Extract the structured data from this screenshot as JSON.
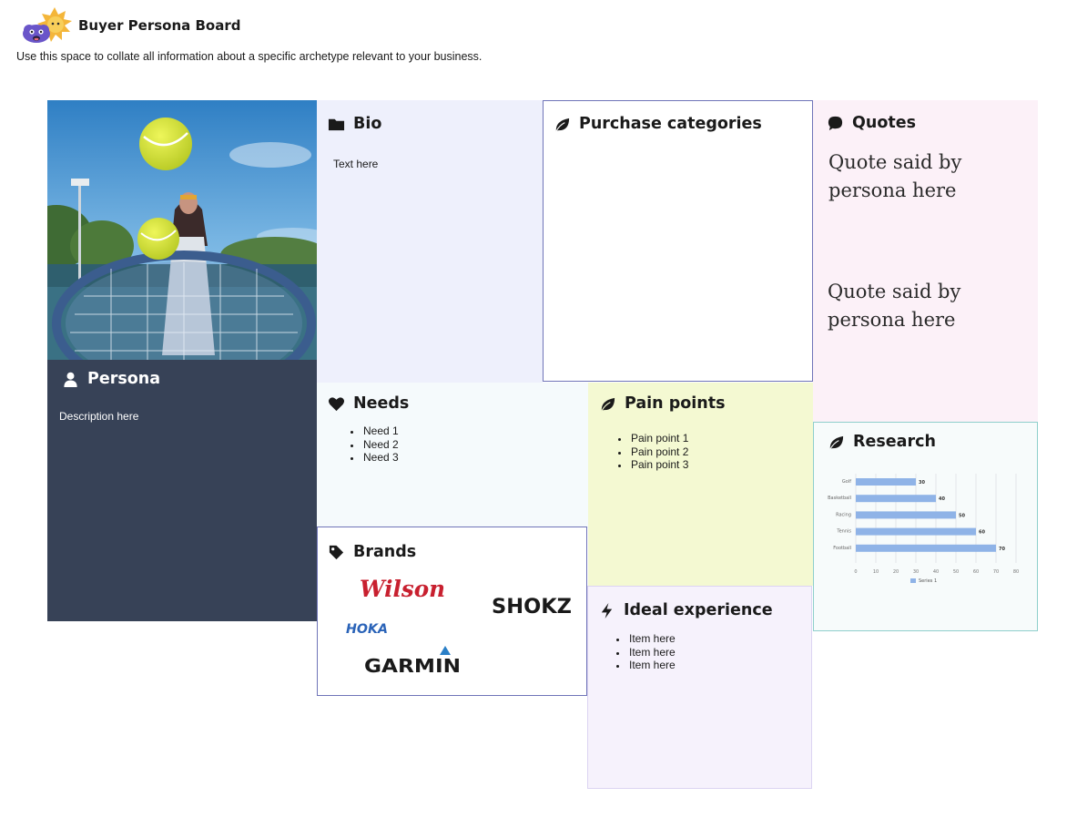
{
  "app": {
    "title": "Buyer Persona Board",
    "subtitle": "Use this space to collate all information about a specific archetype relevant to your business."
  },
  "persona": {
    "title": "Persona",
    "icon": "user-icon",
    "description": "Description here"
  },
  "bio": {
    "title": "Bio",
    "icon": "folder-icon",
    "text": "Text here"
  },
  "purchase": {
    "title": "Purchase categories",
    "icon": "leaf-icon"
  },
  "quotes": {
    "title": "Quotes",
    "icon": "speech-bubble-icon",
    "items": [
      "Quote said by persona here",
      "Quote said by persona here"
    ]
  },
  "needs": {
    "title": "Needs",
    "icon": "heart-icon",
    "items": [
      "Need 1",
      "Need 2",
      "Need 3"
    ]
  },
  "pain": {
    "title": "Pain points",
    "icon": "leaf-icon",
    "items": [
      "Pain point 1",
      "Pain point 2",
      "Pain point 3"
    ]
  },
  "research": {
    "title": "Research",
    "icon": "leaf-icon"
  },
  "brands": {
    "title": "Brands",
    "icon": "tag-icon",
    "logos": [
      "Wilson",
      "SHOKZ",
      "HOKA",
      "GARMIN"
    ]
  },
  "ideal": {
    "title": "Ideal experience",
    "icon": "lightning-icon",
    "items": [
      "Item here",
      "Item here",
      "Item here"
    ]
  },
  "colors": {
    "persona_bg": "#374257",
    "bio_bg": "#eef0fc",
    "quotes_bg": "#fcf1f8",
    "needs_bg": "#f5fafc",
    "pain_bg": "#f4f9d2",
    "ideal_bg": "#f6f2fc",
    "research_bg": "#f7fbfb",
    "bar": "#8fb3e7",
    "wilson": "#c8202f"
  },
  "chart_data": {
    "type": "bar",
    "orientation": "horizontal",
    "categories": [
      "Golf",
      "Basketball",
      "Racing",
      "Tennis",
      "Football"
    ],
    "series": [
      {
        "name": "Series 1",
        "values": [
          30,
          40,
          50,
          60,
          70
        ]
      }
    ],
    "xlim": [
      0,
      80
    ],
    "xticks": [
      0,
      10,
      20,
      30,
      40,
      50,
      60,
      70,
      80
    ],
    "grid": true,
    "legend": "bottom"
  }
}
